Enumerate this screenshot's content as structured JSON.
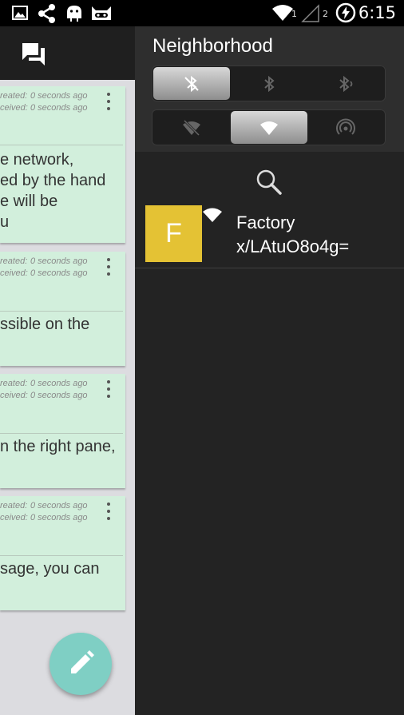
{
  "status_bar": {
    "time": "6:15",
    "wifi_sub": "1",
    "signal_sub": "2"
  },
  "left_pane": {
    "cards": [
      {
        "meta_created_label": "reated:",
        "meta_created_value": "0 seconds ago",
        "meta_received_label": "ceived:",
        "meta_received_value": "0 seconds ago",
        "body_lines": [
          "e network,",
          "ed by the hand",
          "e will be",
          "u"
        ]
      },
      {
        "meta_created_label": "reated:",
        "meta_created_value": "0 seconds ago",
        "meta_received_label": "ceived:",
        "meta_received_value": "0 seconds ago",
        "body_lines": [
          "ssible on the"
        ]
      },
      {
        "meta_created_label": "reated:",
        "meta_created_value": "0 seconds ago",
        "meta_received_label": "ceived:",
        "meta_received_value": "0 seconds ago",
        "body_lines": [
          "n the right pane,"
        ]
      },
      {
        "meta_created_label": "reated:",
        "meta_created_value": "0 seconds ago",
        "meta_received_label": "ceived:",
        "meta_received_value": "0 seconds ago",
        "body_lines": [
          "sage, you can"
        ]
      }
    ]
  },
  "drawer": {
    "title": "Neighborhood",
    "peer": {
      "initial": "F",
      "name": "Factory",
      "key": "x/LAtuO8o4g="
    }
  },
  "colors": {
    "card_bg": "#d2efdc",
    "fab": "#7fcfc4",
    "avatar": "#e4c234",
    "drawer_bg": "#232323"
  }
}
